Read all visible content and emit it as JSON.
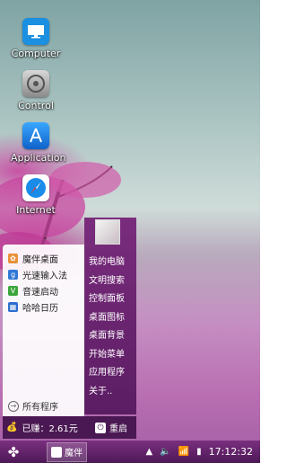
{
  "desktop": {
    "icons": [
      {
        "label": "Computer",
        "icon": "computer-icon"
      },
      {
        "label": "Control",
        "icon": "control-icon"
      },
      {
        "label": "Application",
        "icon": "app-store-icon"
      },
      {
        "label": "Internet",
        "icon": "safari-icon"
      }
    ]
  },
  "start_menu": {
    "left_items": [
      {
        "label": "魔伴桌面",
        "icon": "mobanzhuomian-icon",
        "color": "#e8913a"
      },
      {
        "label": "光速输入法",
        "icon": "input-method-icon",
        "color": "#2f78d6"
      },
      {
        "label": "音速启动",
        "icon": "launcher-v-icon",
        "color": "#3ba63b"
      },
      {
        "label": "哈哈日历",
        "icon": "calendar-icon",
        "color": "#2d6fcf"
      }
    ],
    "all_programs": "所有程序",
    "right_items": [
      "我的电脑",
      "文明搜索",
      "控制面板",
      "桌面图标",
      "桌面背景",
      "开始菜单",
      "应用程序",
      "关于.."
    ],
    "earned": "已赚：2.61元",
    "restart": "重启"
  },
  "taskbar": {
    "app_label": "魔伴",
    "clock": "17:12:32"
  }
}
